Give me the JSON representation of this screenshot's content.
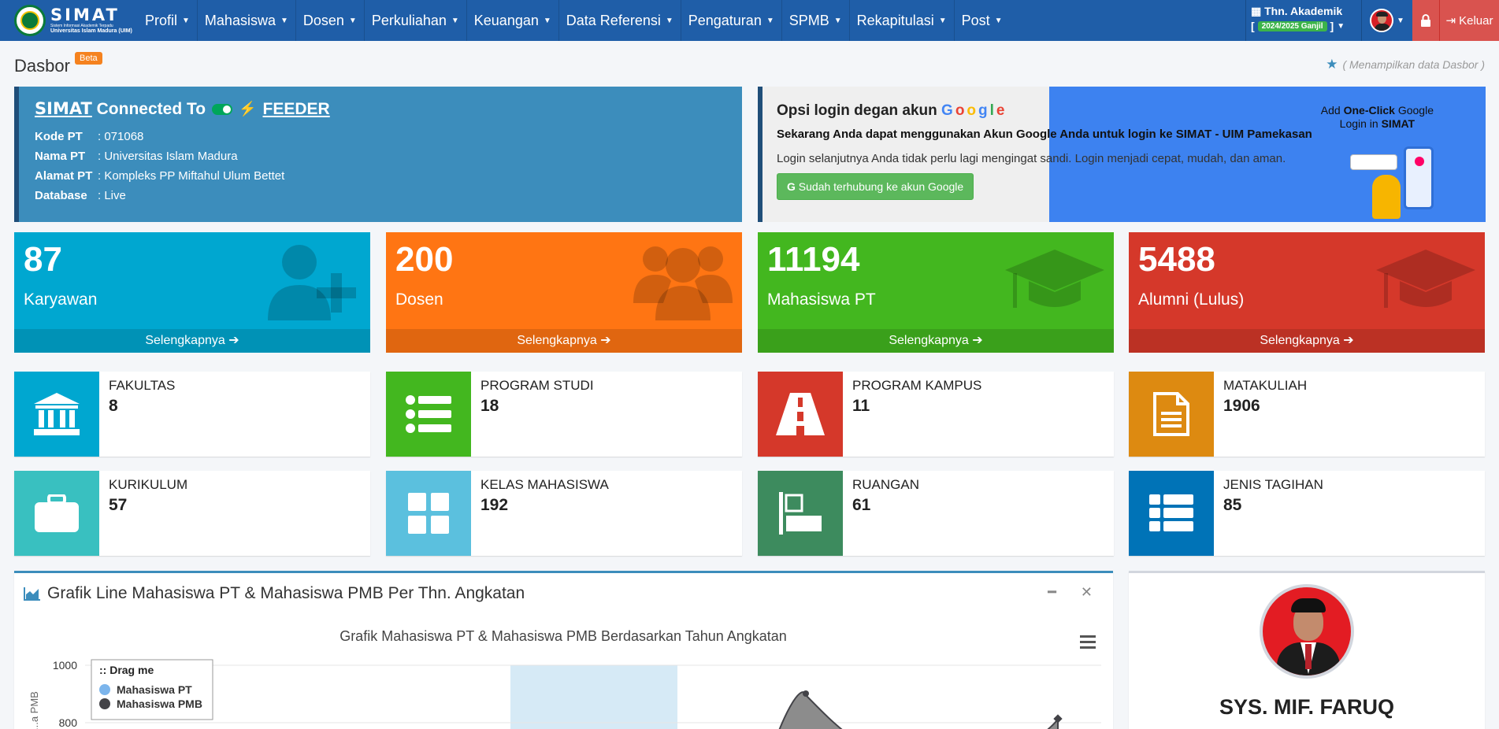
{
  "brand": {
    "name": "SIMAT",
    "tagline": "Sistem Informasi Akademik Terpadu",
    "university": "Universitas Islam Madura (UIM)"
  },
  "nav": {
    "menu": [
      "Profil",
      "Mahasiswa",
      "Dosen",
      "Perkuliahan",
      "Keuangan",
      "Data Referensi",
      "Pengaturan",
      "SPMB",
      "Rekapitulasi",
      "Post"
    ],
    "tahun_label": "Thn. Akademik",
    "tahun_value": "2024/2025 Ganjil",
    "logout": "Keluar"
  },
  "header": {
    "title": "Dasbor",
    "badge": "Beta",
    "breadcrumb": "( Menampilkan data Dasbor )"
  },
  "feeder": {
    "simat": "SIMAT",
    "connected": "Connected To",
    "target": "FEEDER",
    "rows": [
      {
        "key": "Kode PT",
        "value": ": 071068"
      },
      {
        "key": "Nama PT",
        "value": ": Universitas Islam Madura"
      },
      {
        "key": "Alamat PT",
        "value": ": Kompleks PP Miftahul Ulum Bettet"
      },
      {
        "key": "Database",
        "value": ": Live"
      }
    ]
  },
  "google": {
    "title": "Opsi login degan akun",
    "letters": [
      "G",
      "o",
      "o",
      "g",
      "l",
      "e"
    ],
    "letter_colors": [
      "#4285f4",
      "#ea4335",
      "#fbbc05",
      "#4285f4",
      "#34a853",
      "#ea4335"
    ],
    "bold_line": "Sekarang Anda dapat menggunakan Akun Google Anda untuk login ke SIMAT - UIM Pamekasan",
    "line": "Login selanjutnya Anda tidak perlu lagi mengingat sandi. Login menjadi cepat, mudah, dan aman.",
    "button": "Sudah terhubung ke akun Google",
    "promo_add": "Add",
    "promo_oneclick": "One-Click",
    "promo_google": "Google",
    "promo_login": "Login in",
    "promo_simat": "SIMAT"
  },
  "stats": [
    {
      "value": "87",
      "label": "Karyawan",
      "link": "Selengkapnya",
      "icon": "user-plus-icon",
      "color": "#00a7d0"
    },
    {
      "value": "200",
      "label": "Dosen",
      "link": "Selengkapnya",
      "icon": "users-icon",
      "color": "#ff7513"
    },
    {
      "value": "11194",
      "label": "Mahasiswa PT",
      "link": "Selengkapnya",
      "icon": "graduation-cap-icon",
      "color": "#43b71f"
    },
    {
      "value": "5488",
      "label": "Alumni (Lulus)",
      "link": "Selengkapnya",
      "icon": "graduation-cap-icon",
      "color": "#d5382a"
    }
  ],
  "infos": [
    {
      "label": "FAKULTAS",
      "value": "8",
      "icon": "institution-icon",
      "color": "#00a7d0"
    },
    {
      "label": "PROGRAM STUDI",
      "value": "18",
      "icon": "list-icon",
      "color": "#43b71f"
    },
    {
      "label": "PROGRAM KAMPUS",
      "value": "11",
      "icon": "road-icon",
      "color": "#d5382a"
    },
    {
      "label": "MATAKULIAH",
      "value": "1906",
      "icon": "file-text-icon",
      "color": "#dd8a11"
    },
    {
      "label": "KURIKULUM",
      "value": "57",
      "icon": "briefcase-icon",
      "color": "#39c0c0"
    },
    {
      "label": "KELAS MAHASISWA",
      "value": "192",
      "icon": "th-large-icon",
      "color": "#5bc0de"
    },
    {
      "label": "RUANGAN",
      "value": "61",
      "icon": "align-left-icon",
      "color": "#3d8b5e"
    },
    {
      "label": "JENIS TAGIHAN",
      "value": "85",
      "icon": "th-list-icon",
      "color": "#0073b7"
    }
  ],
  "chart_panel": {
    "title": "Grafik Line Mahasiswa PT & Mahasiswa PMB Per Thn. Angkatan"
  },
  "chart_data": {
    "type": "area",
    "title": "Grafik Mahasiswa PT & Mahasiswa PMB Berdasarkan Tahun Angkatan",
    "ylabel": "...a PMB",
    "yticks": [
      "1000",
      "800"
    ],
    "legend_title": ":: Drag me",
    "legend_position": "top-left",
    "series": [
      {
        "name": "Mahasiswa PT",
        "color": "#7cb5ec"
      },
      {
        "name": "Mahasiswa PMB",
        "color": "#434348"
      }
    ]
  },
  "profile": {
    "name": "SYS. MIF. FARUQ"
  }
}
